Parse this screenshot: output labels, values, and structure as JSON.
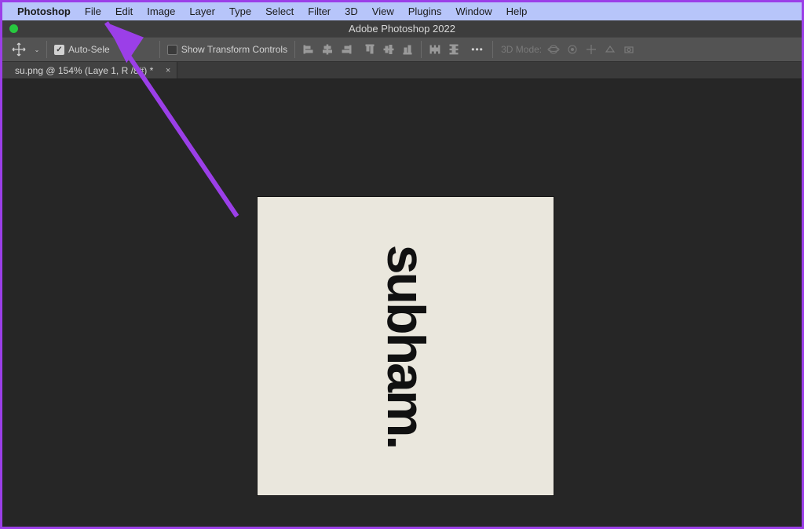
{
  "menubar": {
    "app": "Photoshop",
    "items": [
      "File",
      "Edit",
      "Image",
      "Layer",
      "Type",
      "Select",
      "Filter",
      "3D",
      "View",
      "Plugins",
      "Window",
      "Help"
    ]
  },
  "titlebar": {
    "title": "Adobe Photoshop 2022"
  },
  "options": {
    "auto_select_label": "Auto-Sele",
    "show_transform_label": "Show Transform Controls",
    "mode3d_label": "3D Mode:"
  },
  "tabs": {
    "items": [
      {
        "label": "su.png @ 154% (Laye    1, R    /8#) *"
      }
    ]
  },
  "artboard": {
    "text": "subham."
  },
  "colors": {
    "annotation": "#9b3fe8",
    "menubar_bg": "#b7c5fa"
  }
}
